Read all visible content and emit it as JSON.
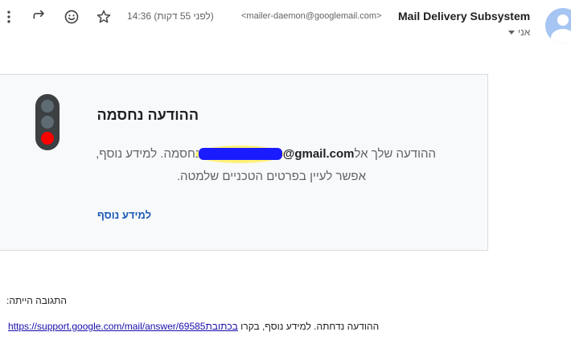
{
  "header": {
    "icons": {
      "more": "more-vert-icon",
      "reply": "reply-icon",
      "emoji": "emoji-icon",
      "star": "star-icon"
    },
    "time": "14:36 (לפני 55 דקות)",
    "from_email": "<mailer-daemon@googlemail.com>",
    "from_name": "Mail Delivery Subsystem",
    "to_label": "אני"
  },
  "card": {
    "title": "ההודעה נחסמה",
    "line1_prefix": "ההודעה שלך אל",
    "address_visible": "@gmail.com",
    "line1_suffix": "נחסמה. למידע נוסף,",
    "line2": "אפשר לעיין בפרטים הטכניים שלמטה.",
    "learn_more": "למידע נוסף"
  },
  "body": {
    "response_label": "התגובה הייתה:",
    "bottom_prefix": "ההודעה נדחתה. למידע נוסף, בקרו ",
    "bottom_link_url": "https://support.google.com/mail/answer/69585",
    "bottom_link_word": "בכתובת"
  },
  "colors": {
    "link_blue": "#1a5ab8",
    "card_bg": "#f8f9fa",
    "red_lamp": "#ff0000",
    "scribble_blue": "#1b1bff",
    "highlight_yellow": "#fff176"
  }
}
